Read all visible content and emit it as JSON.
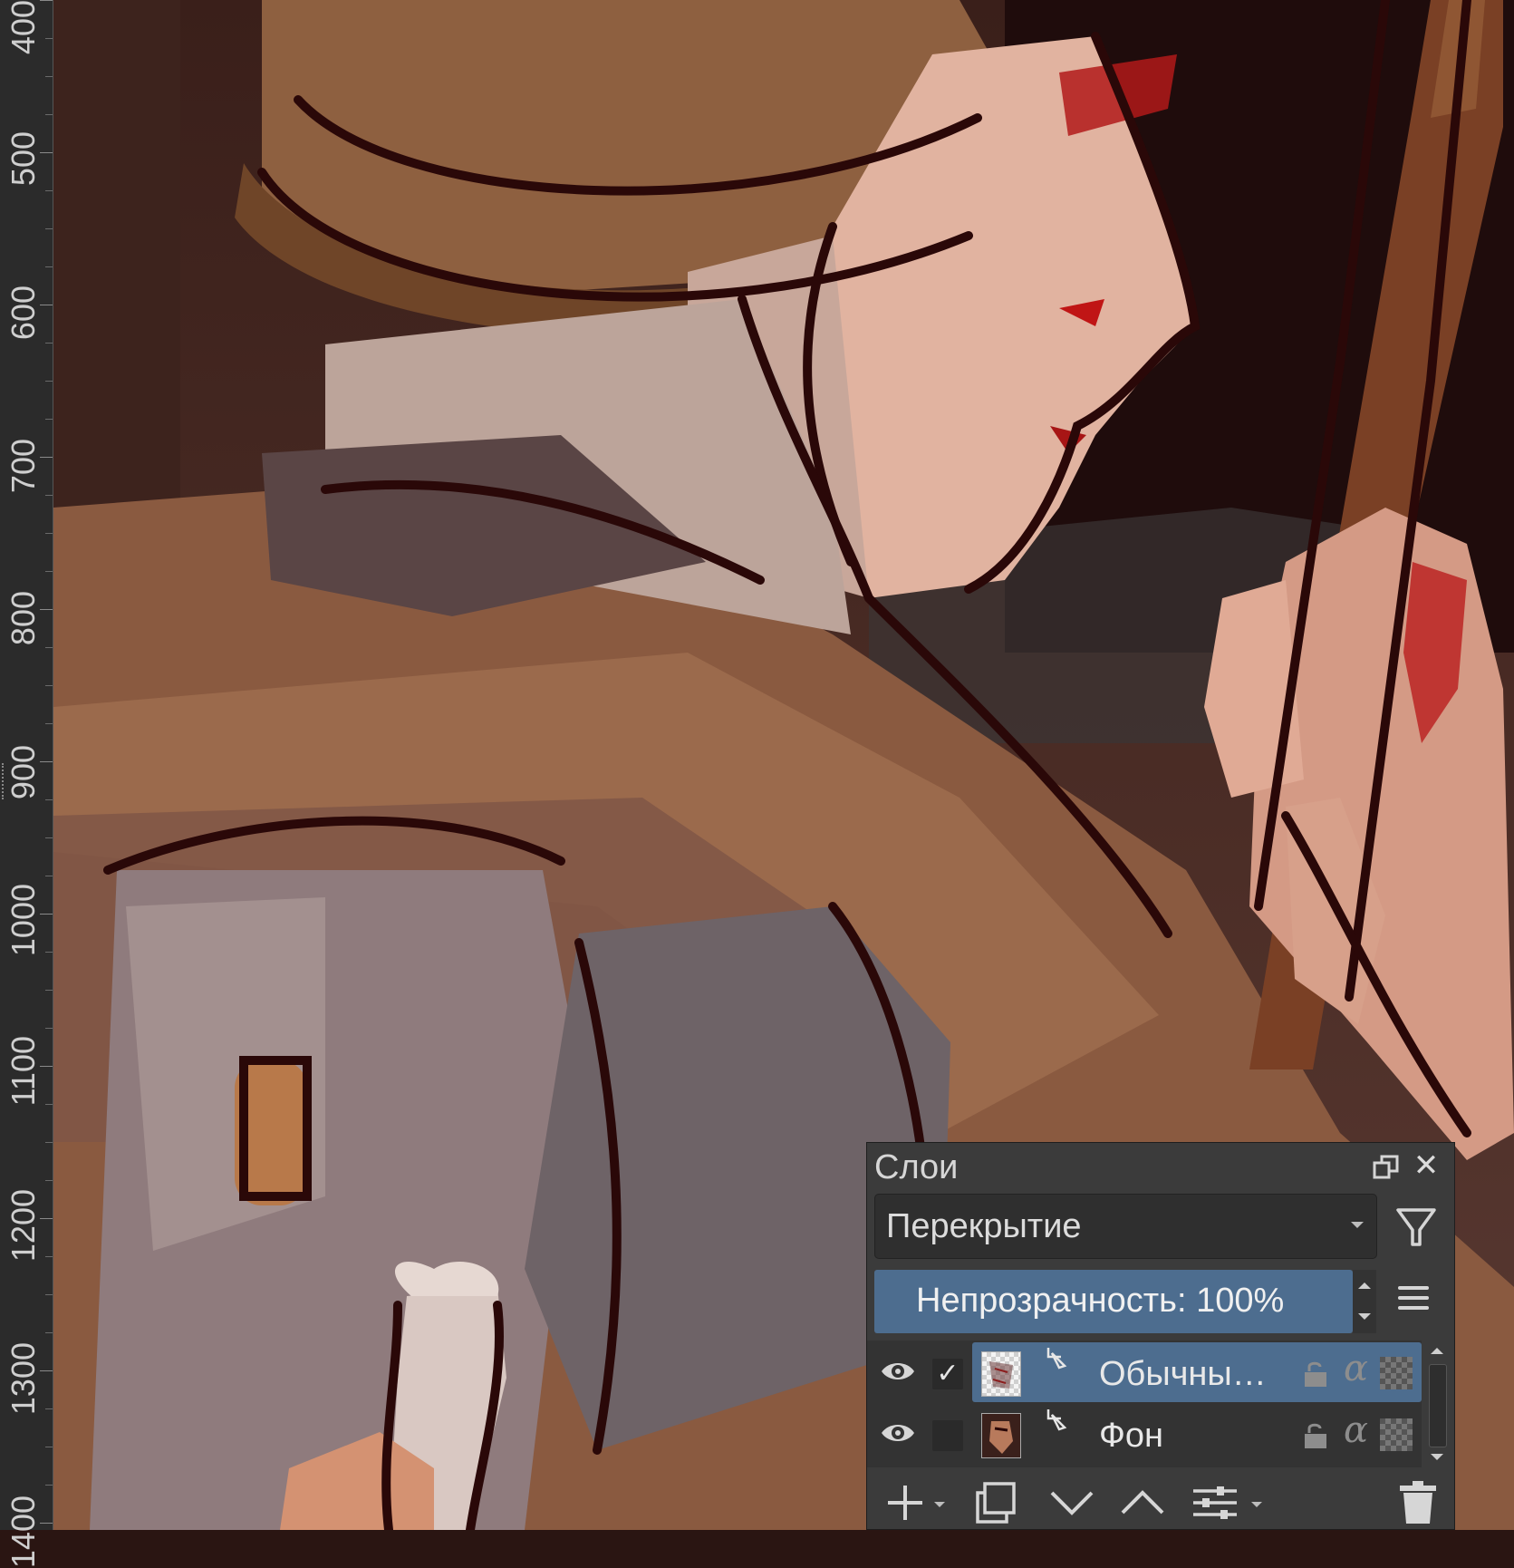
{
  "ruler": {
    "labels": [
      "400",
      "500",
      "600",
      "700",
      "800",
      "900",
      "1000",
      "1100",
      "1200",
      "1300",
      "1400"
    ]
  },
  "layers_docker": {
    "title": "Слои",
    "blend_mode": "Перекрытие",
    "opacity_label": "Непрозрачность:  100%",
    "layers": [
      {
        "name": "Обычны…",
        "visible": true,
        "selected": true,
        "alpha_symbol": "α"
      },
      {
        "name": "Фон",
        "visible": true,
        "selected": false,
        "alpha_symbol": "α"
      }
    ],
    "check_mark": "✓",
    "close_symbol": "✕"
  },
  "colors": {
    "panel_bg": "#3b3b3b",
    "selection": "#4d6d8f",
    "ruler_bg": "#2b2b2b"
  }
}
